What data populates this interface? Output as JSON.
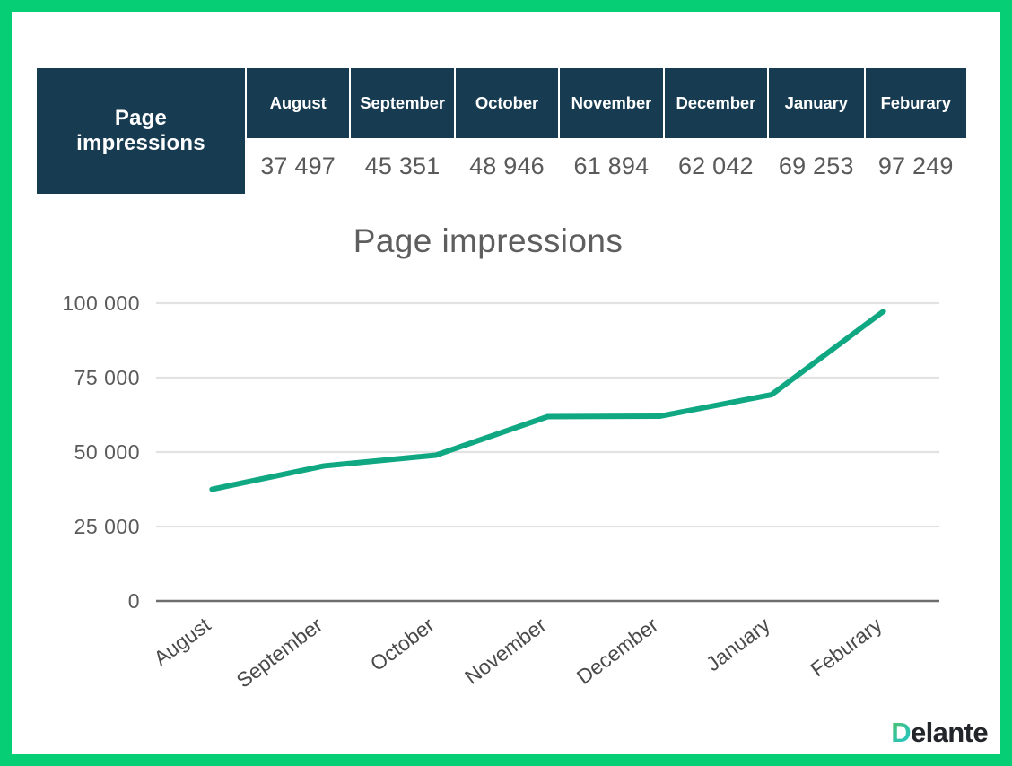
{
  "frame": {
    "border_color": "#06ce74",
    "background": "#ffffff"
  },
  "table": {
    "row_label": "Page\nimpressions",
    "row_label_line1": "Page",
    "row_label_line2": "impressions",
    "header_bg": "#173c52",
    "header_text_color": "#ffffff",
    "value_text_color": "#5a5a5a",
    "columns": [
      {
        "month": "August",
        "value": "37 497"
      },
      {
        "month": "September",
        "value": "45 351"
      },
      {
        "month": "October",
        "value": "48 946"
      },
      {
        "month": "November",
        "value": "61 894"
      },
      {
        "month": "December",
        "value": "62 042"
      },
      {
        "month": "January",
        "value": "69 253"
      },
      {
        "month": "Feburary",
        "value": "97 249"
      }
    ]
  },
  "chart_data": {
    "type": "line",
    "title": "Page impressions",
    "xlabel": "",
    "ylabel": "",
    "categories": [
      "August",
      "September",
      "October",
      "November",
      "December",
      "January",
      "Feburary"
    ],
    "series": [
      {
        "name": "Page impressions",
        "color": "#0fa882",
        "values": [
          37497,
          45351,
          48946,
          61894,
          62042,
          69253,
          97249
        ]
      }
    ],
    "ylim": [
      0,
      100000
    ],
    "ytick_values": [
      0,
      25000,
      50000,
      75000,
      100000
    ],
    "ytick_labels": [
      "0",
      "25 000",
      "50 000",
      "75 000",
      "100 000"
    ],
    "grid": true,
    "grid_color": "#e2e2e2",
    "legend": false,
    "xtick_rotation_deg": -37,
    "title_color": "#5e5e5e"
  },
  "logo": {
    "initial": "D",
    "rest": "elante",
    "gradient_from": "#5bbf55",
    "gradient_to": "#1fc8d6",
    "text_color": "#22262b"
  }
}
